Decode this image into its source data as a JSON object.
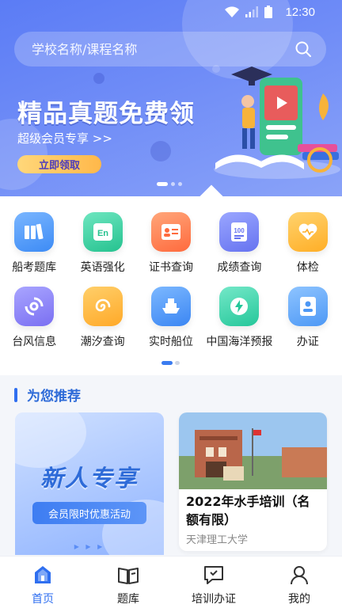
{
  "status": {
    "time": "12:30"
  },
  "search": {
    "placeholder": "学校名称/课程名称"
  },
  "banner": {
    "title": "精品真题免费领",
    "subtitle": "超级会员专享 >>",
    "button": "立即领取"
  },
  "grid": {
    "row1": [
      {
        "label": "船考题库",
        "icon": "book-stack-icon"
      },
      {
        "label": "英语强化",
        "icon": "english-icon"
      },
      {
        "label": "证书查询",
        "icon": "certificate-icon"
      },
      {
        "label": "成绩查询",
        "icon": "score-icon"
      },
      {
        "label": "体检",
        "icon": "health-heart-icon"
      }
    ],
    "row2": [
      {
        "label": "台风信息",
        "icon": "typhoon-icon"
      },
      {
        "label": "潮汐查询",
        "icon": "tide-icon"
      },
      {
        "label": "实时船位",
        "icon": "ship-icon"
      },
      {
        "label": "中国海洋预报",
        "icon": "lightning-icon"
      },
      {
        "label": "办证",
        "icon": "id-card-icon"
      }
    ]
  },
  "recommend": {
    "title": "为您推荐",
    "left_card": {
      "headline": "新人专享",
      "tag": "会员限时优惠活动",
      "arrows": "▶ ▶ ▶"
    },
    "right_card": {
      "title": "2022年水手培训（名额有限）",
      "school": "天津理工大学"
    }
  },
  "nav": [
    {
      "label": "首页",
      "icon": "home-icon",
      "active": true
    },
    {
      "label": "题库",
      "icon": "open-book-icon",
      "active": false
    },
    {
      "label": "培训办证",
      "icon": "chat-check-icon",
      "active": false
    },
    {
      "label": "我的",
      "icon": "user-icon",
      "active": false
    }
  ],
  "colors": {
    "accent": "#2f6ff0",
    "banner": "#5b7cf5",
    "promo_button": "#ffc45c"
  }
}
